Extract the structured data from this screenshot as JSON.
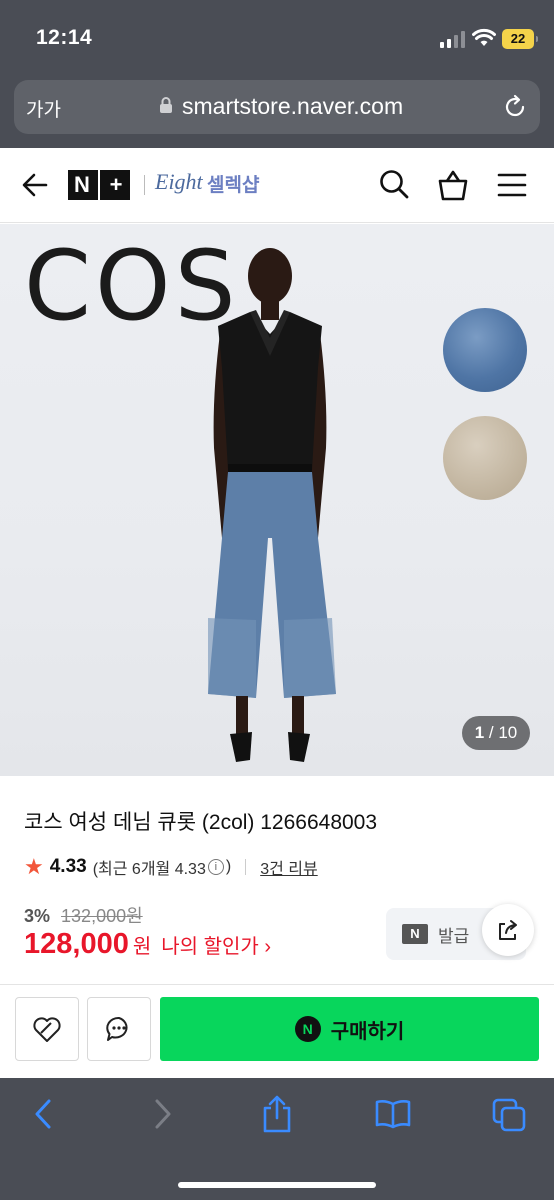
{
  "status": {
    "time": "12:14",
    "battery": "22"
  },
  "browser": {
    "text_size": "가가",
    "url": "smartstore.naver.com"
  },
  "header": {
    "nplus_n": "N",
    "nplus_plus": "+",
    "brand_script": "Eight",
    "brand_store": "셀렉샵"
  },
  "hero": {
    "brand_text": "COS",
    "pager_current": "1",
    "pager_total": " / 10"
  },
  "product": {
    "title": "코스 여성 데님 큐롯 (2col) 1266648003",
    "rating": "4.33",
    "rating_detail_prefix": "(최근 6개월 4.33",
    "rating_detail_suffix": ")",
    "review_count": "3건 리뷰",
    "discount_rate": "3%",
    "original_price": "132,000원",
    "price": "128,000",
    "currency": "원",
    "my_discount": "나의 할인가 ›",
    "coupon_badge": "N",
    "coupon_label": "발급 "
  },
  "actions": {
    "buy_label": "구매하기",
    "buy_logo": "N"
  },
  "colors": {
    "accent_green": "#08d65c",
    "price_red": "#e8162a",
    "star": "#f2563a"
  },
  "icons": [
    "back-icon",
    "search-icon",
    "cart-icon",
    "menu-icon",
    "share-icon",
    "zzim-icon",
    "talk-icon",
    "lock-icon",
    "reload-icon",
    "safari-back-icon",
    "safari-forward-icon",
    "safari-share-icon",
    "bookmarks-icon",
    "tabs-icon"
  ]
}
